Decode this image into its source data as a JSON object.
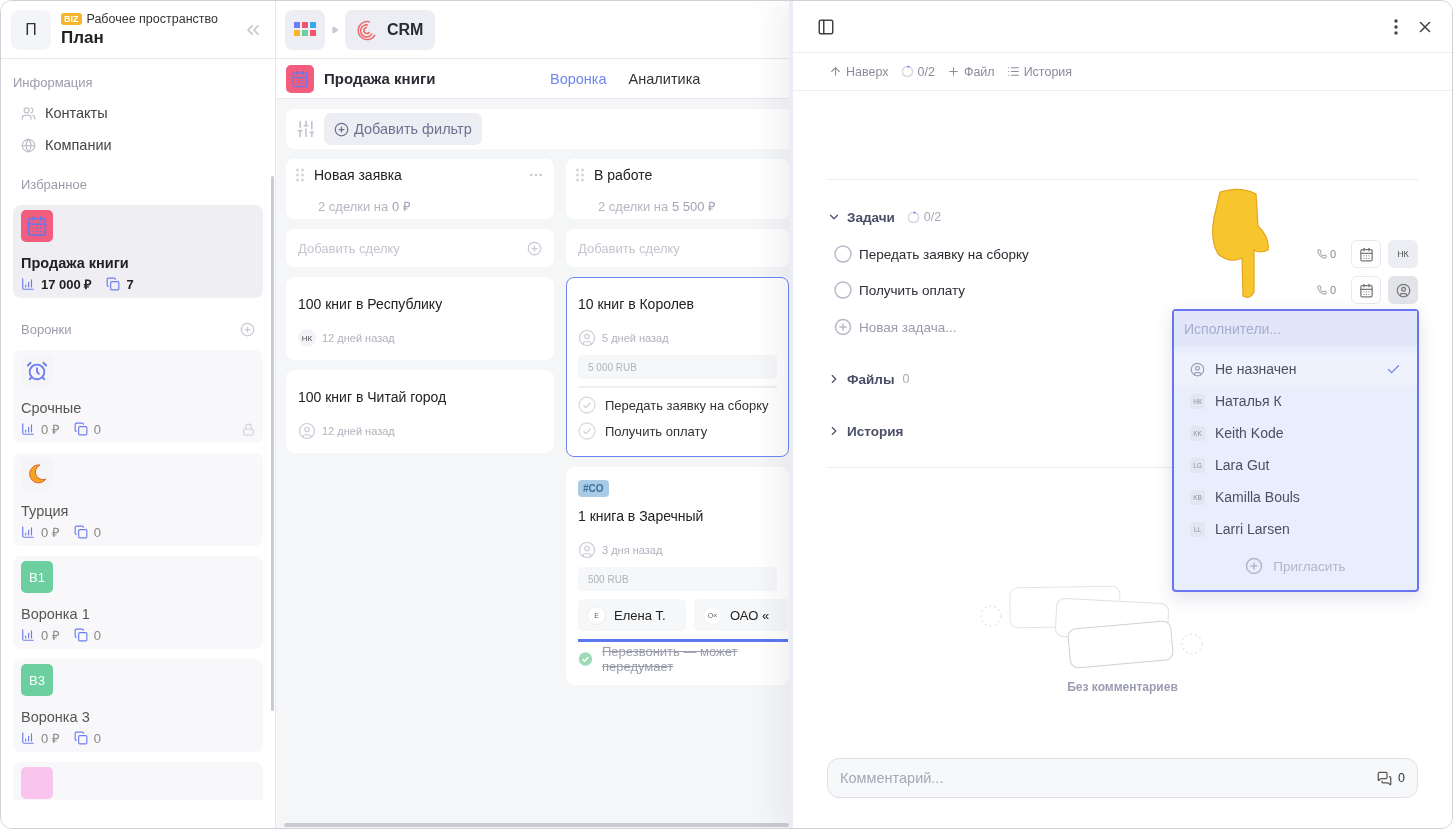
{
  "workspace": {
    "avatar": "П",
    "badge": "BIZ",
    "label": "Рабочее пространство",
    "name": "План"
  },
  "sidebar": {
    "info_heading": "Информация",
    "info_items": [
      {
        "kind": "contacts",
        "label": "Контакты"
      },
      {
        "kind": "companies",
        "label": "Компании"
      }
    ],
    "favorites_heading": "Избранное",
    "favorites": [
      {
        "name": "Продажа книги",
        "amount": "17 000 ₽",
        "deals": "7",
        "selected": true
      }
    ],
    "funnels_heading": "Воронки",
    "funnels": [
      {
        "kind": "alarm",
        "name": "Срочные",
        "amount": "0 ₽",
        "deals": "0",
        "locked": true
      },
      {
        "kind": "moon",
        "name": "Турция",
        "amount": "0 ₽",
        "deals": "0",
        "locked": false
      },
      {
        "kind": "initials",
        "initials": "В1",
        "color": "#6ccf9f",
        "name": "Воронка 1",
        "amount": "0 ₽",
        "deals": "0",
        "locked": false
      },
      {
        "kind": "initials",
        "initials": "В3",
        "color": "#6ccf9f",
        "name": "Воронка 3",
        "amount": "0 ₽",
        "deals": "0",
        "locked": false
      },
      {
        "kind": "initials",
        "color": "#f9c5ee"
      }
    ]
  },
  "board": {
    "app": "CRM",
    "pipeline": "Продажа книги",
    "tabs": [
      {
        "label": "Воронка",
        "selected": true
      },
      {
        "label": "Аналитика",
        "selected": false
      }
    ],
    "filter_button": "Добавить фильтр",
    "columns": [
      {
        "title": "Новая заявка",
        "summary": "2 сделки на **0 ₽**",
        "add_placeholder": "Добавить сделку",
        "controls": true,
        "cards": [
          {
            "title": "100 книг в Республику",
            "avatar": {
              "kind": "initials",
              "text": "НК"
            },
            "time": "12 дней назад",
            "selected": false
          },
          {
            "title": "100 книг в Читай город",
            "avatar": {
              "kind": "person"
            },
            "time": "12 дней назад",
            "selected": false
          }
        ]
      },
      {
        "title": "В работе",
        "summary": "2 сделки на **5 500 ₽**",
        "add_placeholder": "Добавить сделку",
        "controls": false,
        "cards": [
          {
            "title": "10 книг в Королев",
            "avatar": {
              "kind": "person"
            },
            "time": "5 дней назад",
            "amount": "5 000 RUB",
            "selected": true,
            "tasks": [
              {
                "title": "Передать заявку на сборку",
                "done": false
              },
              {
                "title": "Получить оплату",
                "done": false
              }
            ]
          },
          {
            "tag": "#CO",
            "title": "1 книга в Заречный",
            "avatar": {
              "kind": "person"
            },
            "time": "3 дня назад",
            "amount": "500 RUB",
            "selected": false,
            "contacts": [
              {
                "initial": "Е",
                "name": "Елена Т."
              },
              {
                "initial": "О«",
                "name": "ОАО «"
              }
            ],
            "progress": {
              "level": 1
            },
            "tasks": [
              {
                "title": "Перезвонить — может передумает",
                "done": true
              }
            ]
          }
        ]
      }
    ]
  },
  "drawer": {
    "toolbar": [
      {
        "kind": "up",
        "label": "Наверх"
      },
      {
        "kind": "progress",
        "label": "0/2"
      },
      {
        "kind": "add",
        "label": "Файл"
      },
      {
        "kind": "list",
        "label": "История"
      }
    ],
    "tasks_section": {
      "title": "Задачи",
      "progress": "0/2",
      "expanded": true,
      "tasks": [
        {
          "title": "Передать заявку на сборку",
          "done": false,
          "calls": "0",
          "assignee": {
            "kind": "initials",
            "text": "НК"
          },
          "picker_open": false
        },
        {
          "title": "Получить оплату",
          "done": false,
          "calls": "0",
          "assignee": {
            "kind": "person"
          },
          "picker_open": true
        }
      ],
      "new_task_placeholder": "Новая задача..."
    },
    "files_section": {
      "title": "Файлы",
      "count": "0",
      "expanded": false
    },
    "history_section": {
      "title": "История",
      "expanded": false
    },
    "empty_comments": "Без комментариев",
    "comment": {
      "placeholder": "Комментарий...",
      "count": "0"
    },
    "assignee_picker": {
      "placeholder": "Исполнители...",
      "options": [
        {
          "kind": "person",
          "name": "Не назначен",
          "selected": true
        },
        {
          "kind": "initials",
          "initials": "НК",
          "name": "Наталья К",
          "selected": false
        },
        {
          "kind": "initials",
          "initials": "KK",
          "name": "Keith Kode",
          "selected": false
        },
        {
          "kind": "initials",
          "initials": "LG",
          "name": "Lara Gut",
          "selected": false
        },
        {
          "kind": "initials",
          "initials": "KB",
          "name": "Kamilla Bouls",
          "selected": false
        },
        {
          "kind": "initials",
          "initials": "LL",
          "name": "Larri Larsen",
          "selected": false
        }
      ],
      "invite": "Пригласить"
    }
  }
}
